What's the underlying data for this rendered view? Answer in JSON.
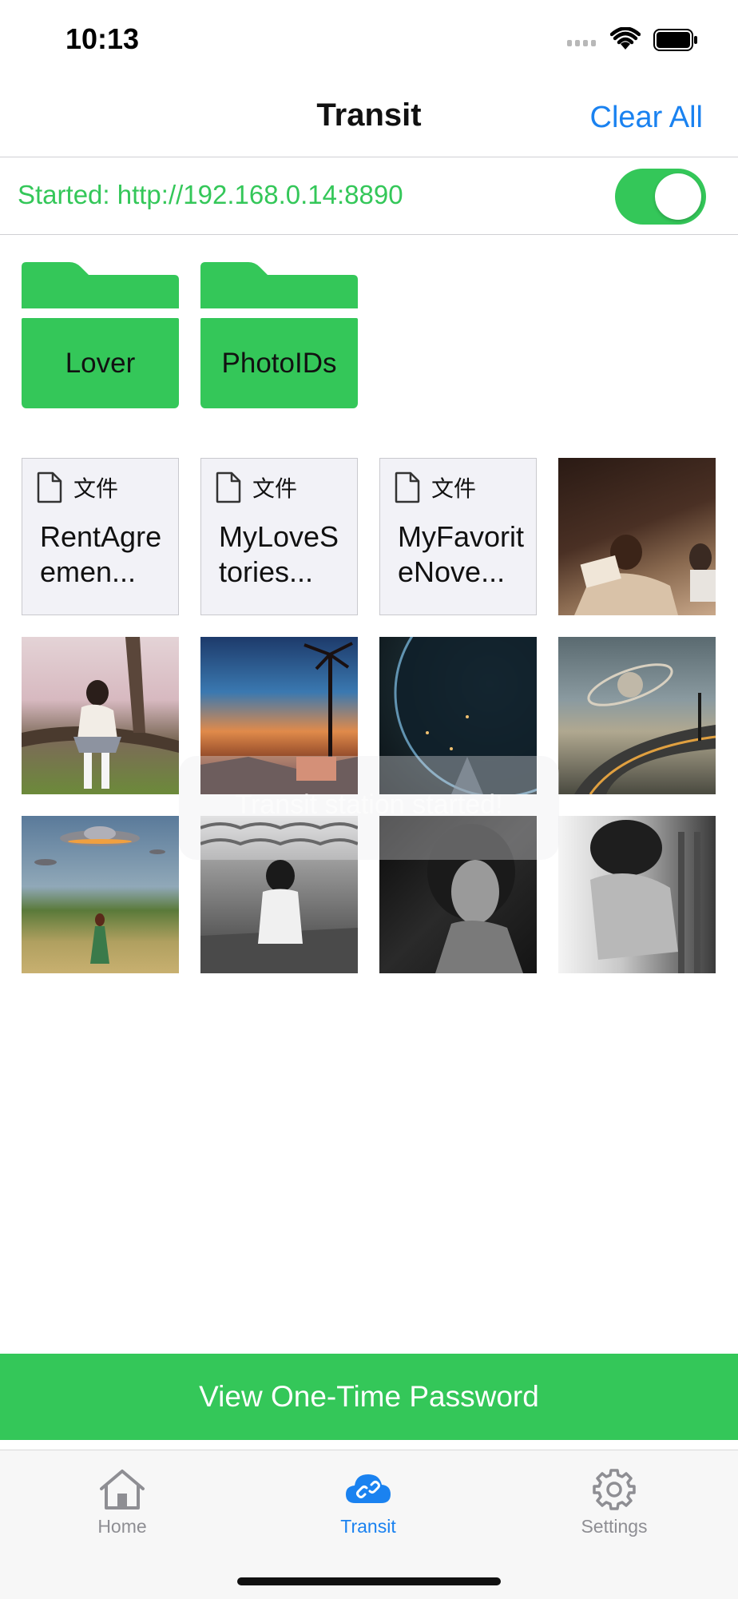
{
  "status_bar": {
    "time": "10:13"
  },
  "nav": {
    "title": "Transit",
    "clear_all": "Clear All"
  },
  "server": {
    "status_text": "Started: http://192.168.0.14:8890",
    "toggle_on": true
  },
  "folders": [
    {
      "name": "Lover"
    },
    {
      "name": "PhotoIDs"
    }
  ],
  "files": [
    {
      "type_label": "文件",
      "name": "RentAgreemen..."
    },
    {
      "type_label": "文件",
      "name": "MyLoveStories..."
    },
    {
      "type_label": "文件",
      "name": "MyFavoriteNove..."
    }
  ],
  "photos": [
    {
      "icon": "photo-woman-reading-bed"
    },
    {
      "icon": "photo-girl-cherry-blossom-tree"
    },
    {
      "icon": "photo-sunset-palm-sky"
    },
    {
      "icon": "photo-earth-from-space"
    },
    {
      "icon": "photo-coastal-road-planet"
    },
    {
      "icon": "photo-ufo-field-girl"
    },
    {
      "icon": "photo-bw-girl-rooftop"
    },
    {
      "icon": "photo-bw-portrait-curly-hair"
    },
    {
      "icon": "photo-bw-curly-hair-sitting"
    }
  ],
  "toast": {
    "text": "Transit station started!"
  },
  "otp_button": {
    "label": "View One-Time Password"
  },
  "tab_bar": {
    "items": [
      {
        "label": "Home",
        "icon": "house-icon",
        "active": false
      },
      {
        "label": "Transit",
        "icon": "cloud-link-icon",
        "active": true
      },
      {
        "label": "Settings",
        "icon": "gear-icon",
        "active": false
      }
    ]
  },
  "colors": {
    "accent_green": "#34c759",
    "link_blue": "#1a82f0",
    "inactive_gray": "#8e8e93"
  }
}
